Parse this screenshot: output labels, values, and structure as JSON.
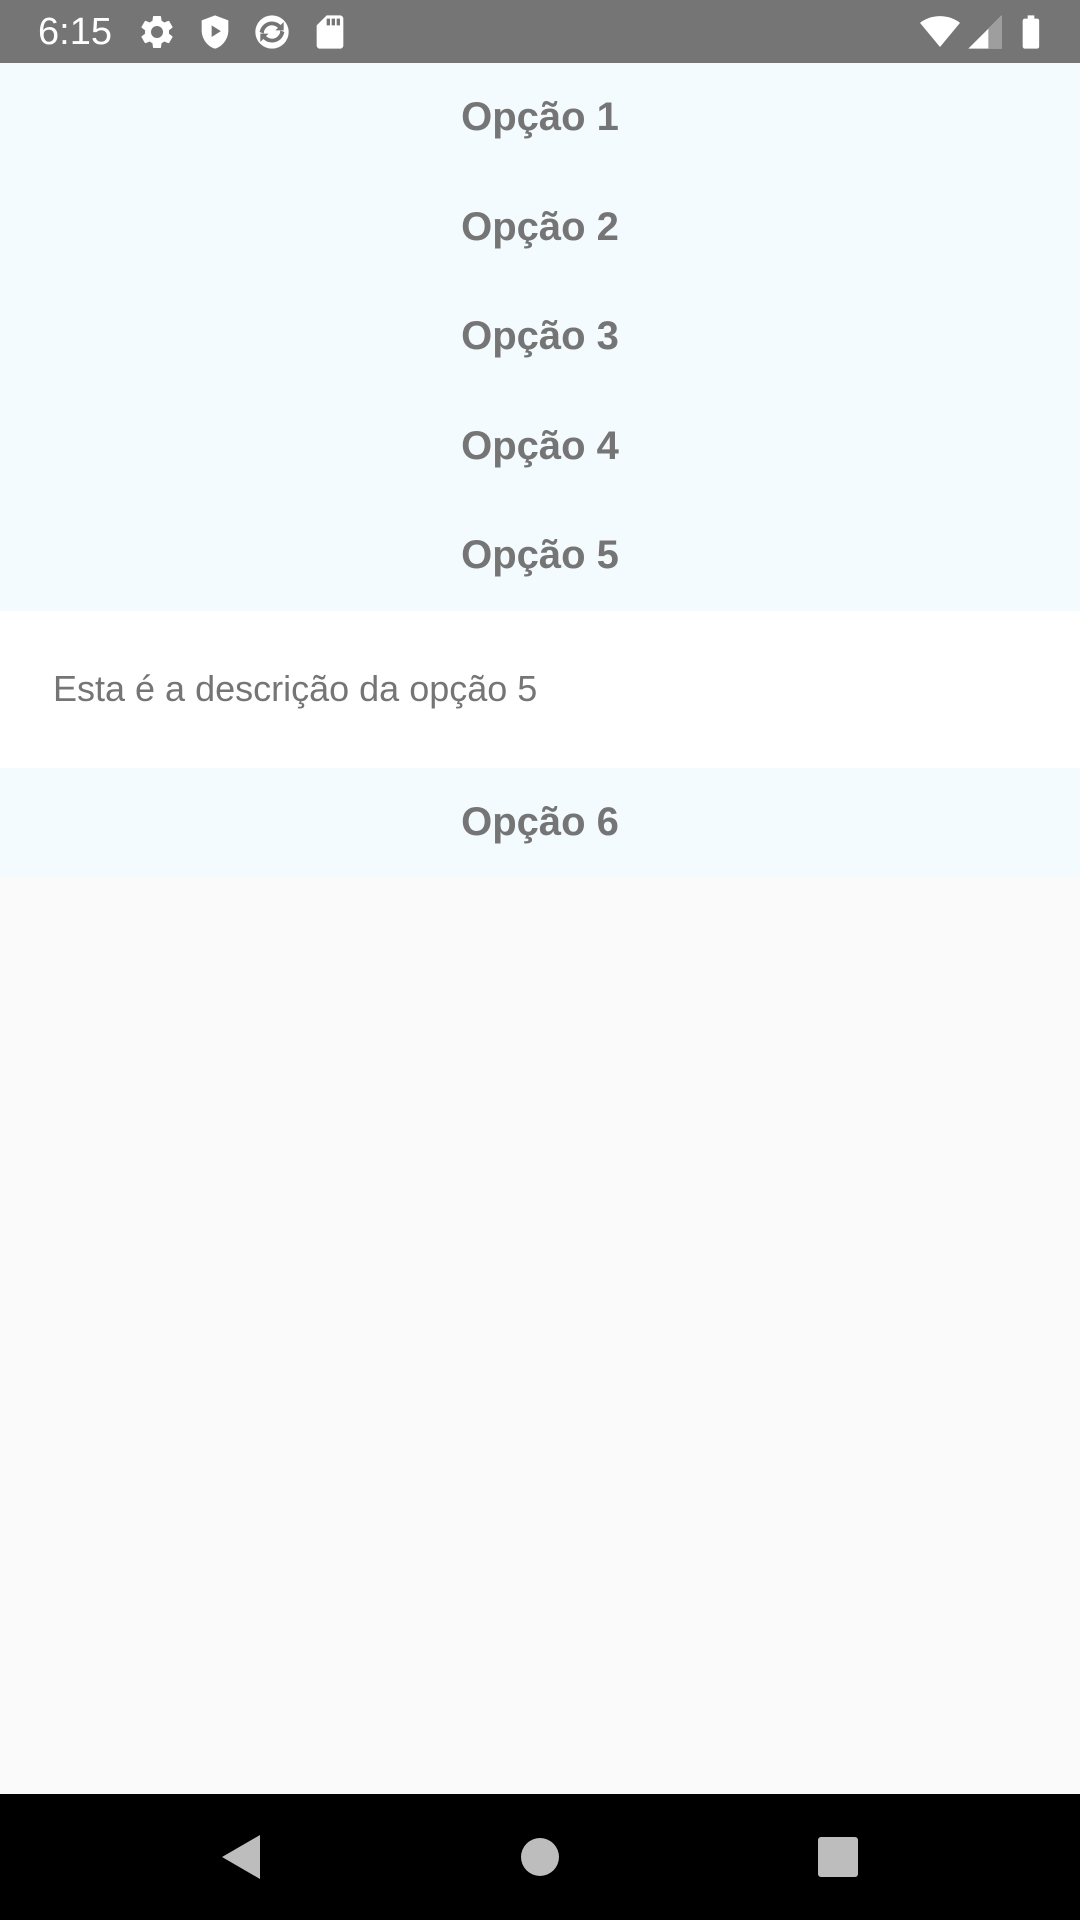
{
  "status_bar": {
    "time": "6:15",
    "left_icons": [
      "gear-icon",
      "shield-play-icon",
      "sync-app-icon",
      "sd-card-icon"
    ],
    "right_icons": [
      "wifi-icon",
      "signal-icon",
      "battery-icon"
    ],
    "background": "#757575"
  },
  "accordion": {
    "items": [
      {
        "title": "Opção 1",
        "expanded": false
      },
      {
        "title": "Opção 2",
        "expanded": false
      },
      {
        "title": "Opção 3",
        "expanded": false
      },
      {
        "title": "Opção 4",
        "expanded": false
      },
      {
        "title": "Opção 5",
        "expanded": true,
        "description": "Esta é a descrição da opção 5"
      },
      {
        "title": "Opção 6",
        "expanded": false
      }
    ],
    "header_background": "#f3fbff",
    "text_color": "#757575"
  },
  "nav_bar": {
    "buttons": [
      "back-icon",
      "home-icon",
      "recents-icon"
    ]
  }
}
